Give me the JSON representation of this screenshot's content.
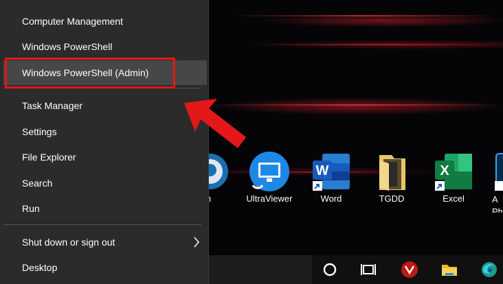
{
  "menu": {
    "items": [
      {
        "label": "Computer Management"
      },
      {
        "label": "Windows PowerShell"
      },
      {
        "label": "Windows PowerShell (Admin)"
      },
      {
        "label": "Task Manager"
      },
      {
        "label": "Settings"
      },
      {
        "label": "File Explorer"
      },
      {
        "label": "Search"
      },
      {
        "label": "Run"
      },
      {
        "label": "Shut down or sign out"
      },
      {
        "label": "Desktop"
      }
    ]
  },
  "desktop": {
    "icons": [
      {
        "label": "am",
        "icon": "steam-icon"
      },
      {
        "label": "UltraViewer",
        "icon": "ultraviewer-icon"
      },
      {
        "label": "Word",
        "icon": "word-icon"
      },
      {
        "label": "TGDD",
        "icon": "folder-icon"
      },
      {
        "label": "Excel",
        "icon": "excel-icon"
      },
      {
        "label": "A\nPh",
        "icon": "app-icon"
      }
    ]
  },
  "taskbar": {
    "icons": [
      "cortana-icon",
      "task-view-icon",
      "antivirus-icon",
      "file-explorer-icon",
      "edge-icon"
    ]
  },
  "colors": {
    "highlight_box": "#e41818",
    "arrow": "#e41818",
    "menu_bg": "#2b2b2b",
    "hover_bg": "#474747"
  }
}
